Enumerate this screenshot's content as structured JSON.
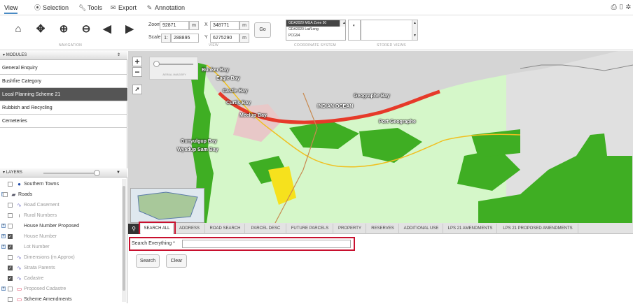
{
  "menu": {
    "view": "View",
    "selection": "Selection",
    "tools": "Tools",
    "export": "Export",
    "annotation": "Annotation"
  },
  "toolbar": {
    "navigation_label": "NAVIGATION",
    "view_label": "VIEW",
    "coord_label": "COORDINATE SYSTEM",
    "stored_label": "STORED VIEWS",
    "zoom_label": "Zoom",
    "zoom_value": "92871",
    "zoom_unit": "m",
    "scale_label": "Scale",
    "scale_prefix": "1:",
    "scale_value": "288895",
    "x_label": "X",
    "x_value": "348771",
    "x_unit": "m",
    "y_label": "Y",
    "y_value": "6275290",
    "y_unit": "m",
    "go_label": "Go",
    "coord_systems": [
      "GDA2020 MGA Zone 50",
      "GDA2020 Lat/Long",
      "PCG94"
    ]
  },
  "modules": {
    "header": "MODULES",
    "items": [
      "General Enquiry",
      "Bushfire Category",
      "Local Planning Scheme 21",
      "Rubbish and Recycling",
      "Cemeteries"
    ]
  },
  "layers": {
    "header": "LAYERS",
    "items": [
      {
        "name": "Southern Towns",
        "checked": false,
        "dim": false,
        "icon": "dot-icon"
      },
      {
        "name": "Roads",
        "checked": false,
        "dim": false,
        "icon": "layers-icon"
      },
      {
        "name": "Road Casement",
        "checked": false,
        "dim": true,
        "icon": "line-icon"
      },
      {
        "name": "Rural Numbers",
        "checked": false,
        "dim": true,
        "icon": "text-icon"
      },
      {
        "name": "House Number Proposed",
        "checked": false,
        "dim": false,
        "icon": "none"
      },
      {
        "name": "House Number",
        "checked": true,
        "dim": true,
        "icon": "none"
      },
      {
        "name": "Lot Number",
        "checked": true,
        "dim": true,
        "icon": "none"
      },
      {
        "name": "Dimensions (m Approx)",
        "checked": false,
        "dim": true,
        "icon": "line-icon"
      },
      {
        "name": "Strata Parents",
        "checked": true,
        "dim": true,
        "icon": "line-icon"
      },
      {
        "name": "Cadastre",
        "checked": true,
        "dim": true,
        "icon": "line-icon"
      },
      {
        "name": "Proposed Cadastre",
        "checked": false,
        "dim": true,
        "icon": "polygon-icon"
      },
      {
        "name": "Scheme Amendments",
        "checked": false,
        "dim": false,
        "icon": "polygon-icon"
      }
    ]
  },
  "map": {
    "aerial_label": "AERIAL IMAGERY",
    "labels": [
      "Bunker Bay",
      "Eagle Bay",
      "Castle Bay",
      "Curtis Bay",
      "Meelup Bay",
      "INDIAN OCEAN",
      "Geographe Bay",
      "Port Geographe",
      "Gunyulgup Bay",
      "Wyadup Sam Bay"
    ]
  },
  "tabs": [
    "SEARCH ALL",
    "ADDRESS",
    "ROAD SEARCH",
    "PARCEL DESC",
    "FUTURE PARCELS",
    "PROPERTY",
    "RESERVES",
    "ADDITIONAL USE",
    "LPS 21 AMENDMENTS",
    "LPS 21 PROPOSED AMENDMENTS"
  ],
  "search": {
    "label": "Search Everything *",
    "value": "",
    "search_btn": "Search",
    "clear_btn": "Clear"
  },
  "colors": {
    "land": "#d5f7c9",
    "reserve": "#3fae23",
    "ocean": "#d5d5d5",
    "highlight": "#c8102e",
    "tab_active_border": "#c8102e"
  }
}
